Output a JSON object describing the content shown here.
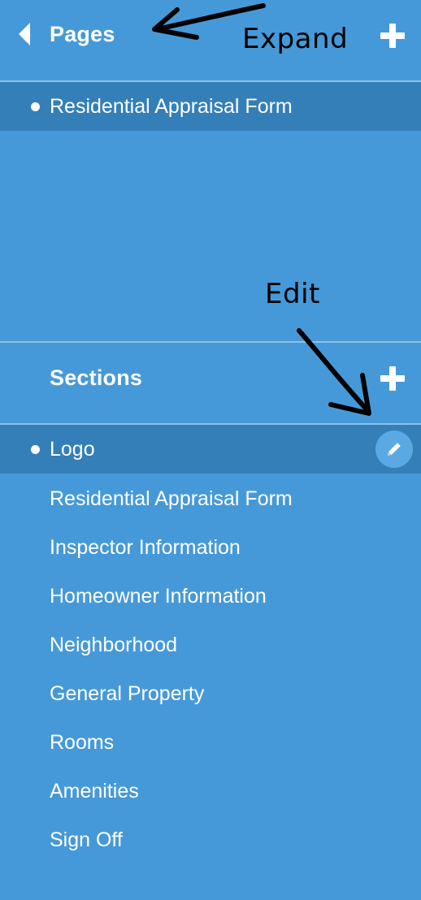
{
  "pages": {
    "title": "Pages",
    "items": [
      {
        "label": "Residential Appraisal Form",
        "selected": true
      }
    ]
  },
  "sections": {
    "title": "Sections",
    "items": [
      {
        "label": "Logo",
        "selected": true
      },
      {
        "label": "Residential Appraisal Form"
      },
      {
        "label": "Inspector Information"
      },
      {
        "label": "Homeowner Information"
      },
      {
        "label": "Neighborhood"
      },
      {
        "label": "General Property"
      },
      {
        "label": "Rooms"
      },
      {
        "label": "Amenities"
      },
      {
        "label": "Sign Off"
      }
    ]
  },
  "annotations": {
    "expand": "Expand",
    "edit": "Edit"
  },
  "icons": {
    "back": "chevron-left-icon",
    "add": "plus-icon",
    "edit": "pencil-icon"
  },
  "colors": {
    "panel": "#4699d8",
    "selected_row": "#347fb8",
    "divider": "#8ec0e8",
    "edit_button": "#5aa9e4",
    "text": "#ffffff",
    "annotation": "#000000"
  }
}
